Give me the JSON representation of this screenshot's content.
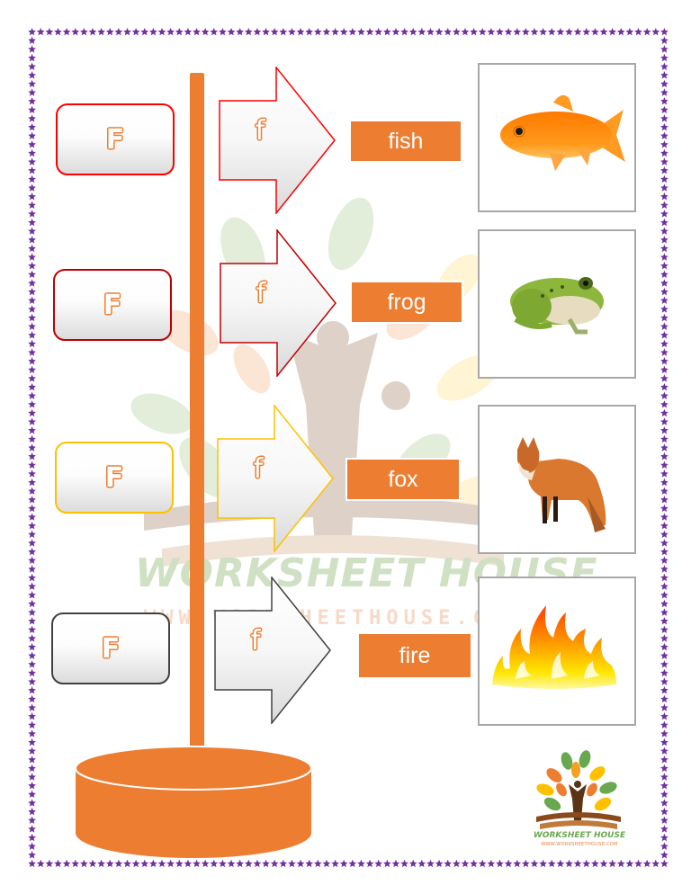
{
  "worksheet": {
    "uppercase_letter": "F",
    "lowercase_letter": "f",
    "colors": {
      "border_stars": "#7030a0",
      "accent_orange": "#ed7d31",
      "row_outline": [
        "#ff0000",
        "#c00000",
        "#ffc000",
        "#404040"
      ]
    },
    "rows": [
      {
        "upper": "F",
        "lower": "f",
        "word": "fish",
        "picture": "goldfish",
        "outline": "#ff0000"
      },
      {
        "upper": "F",
        "lower": "f",
        "word": "frog",
        "picture": "green-frog",
        "outline": "#c00000"
      },
      {
        "upper": "F",
        "lower": "f",
        "word": "fox",
        "picture": "red-fox",
        "outline": "#ffc000"
      },
      {
        "upper": "F",
        "lower": "f",
        "word": "fire",
        "picture": "flames",
        "outline": "#404040"
      }
    ]
  },
  "watermark": {
    "title": "WORKSHEET HOUSE",
    "url": "WWW.WORKSHEETHOUSE.COM"
  },
  "logo": {
    "title": "WORKSHEET HOUSE",
    "url": "WWW.WORKSHEETHOUSE.COM"
  }
}
